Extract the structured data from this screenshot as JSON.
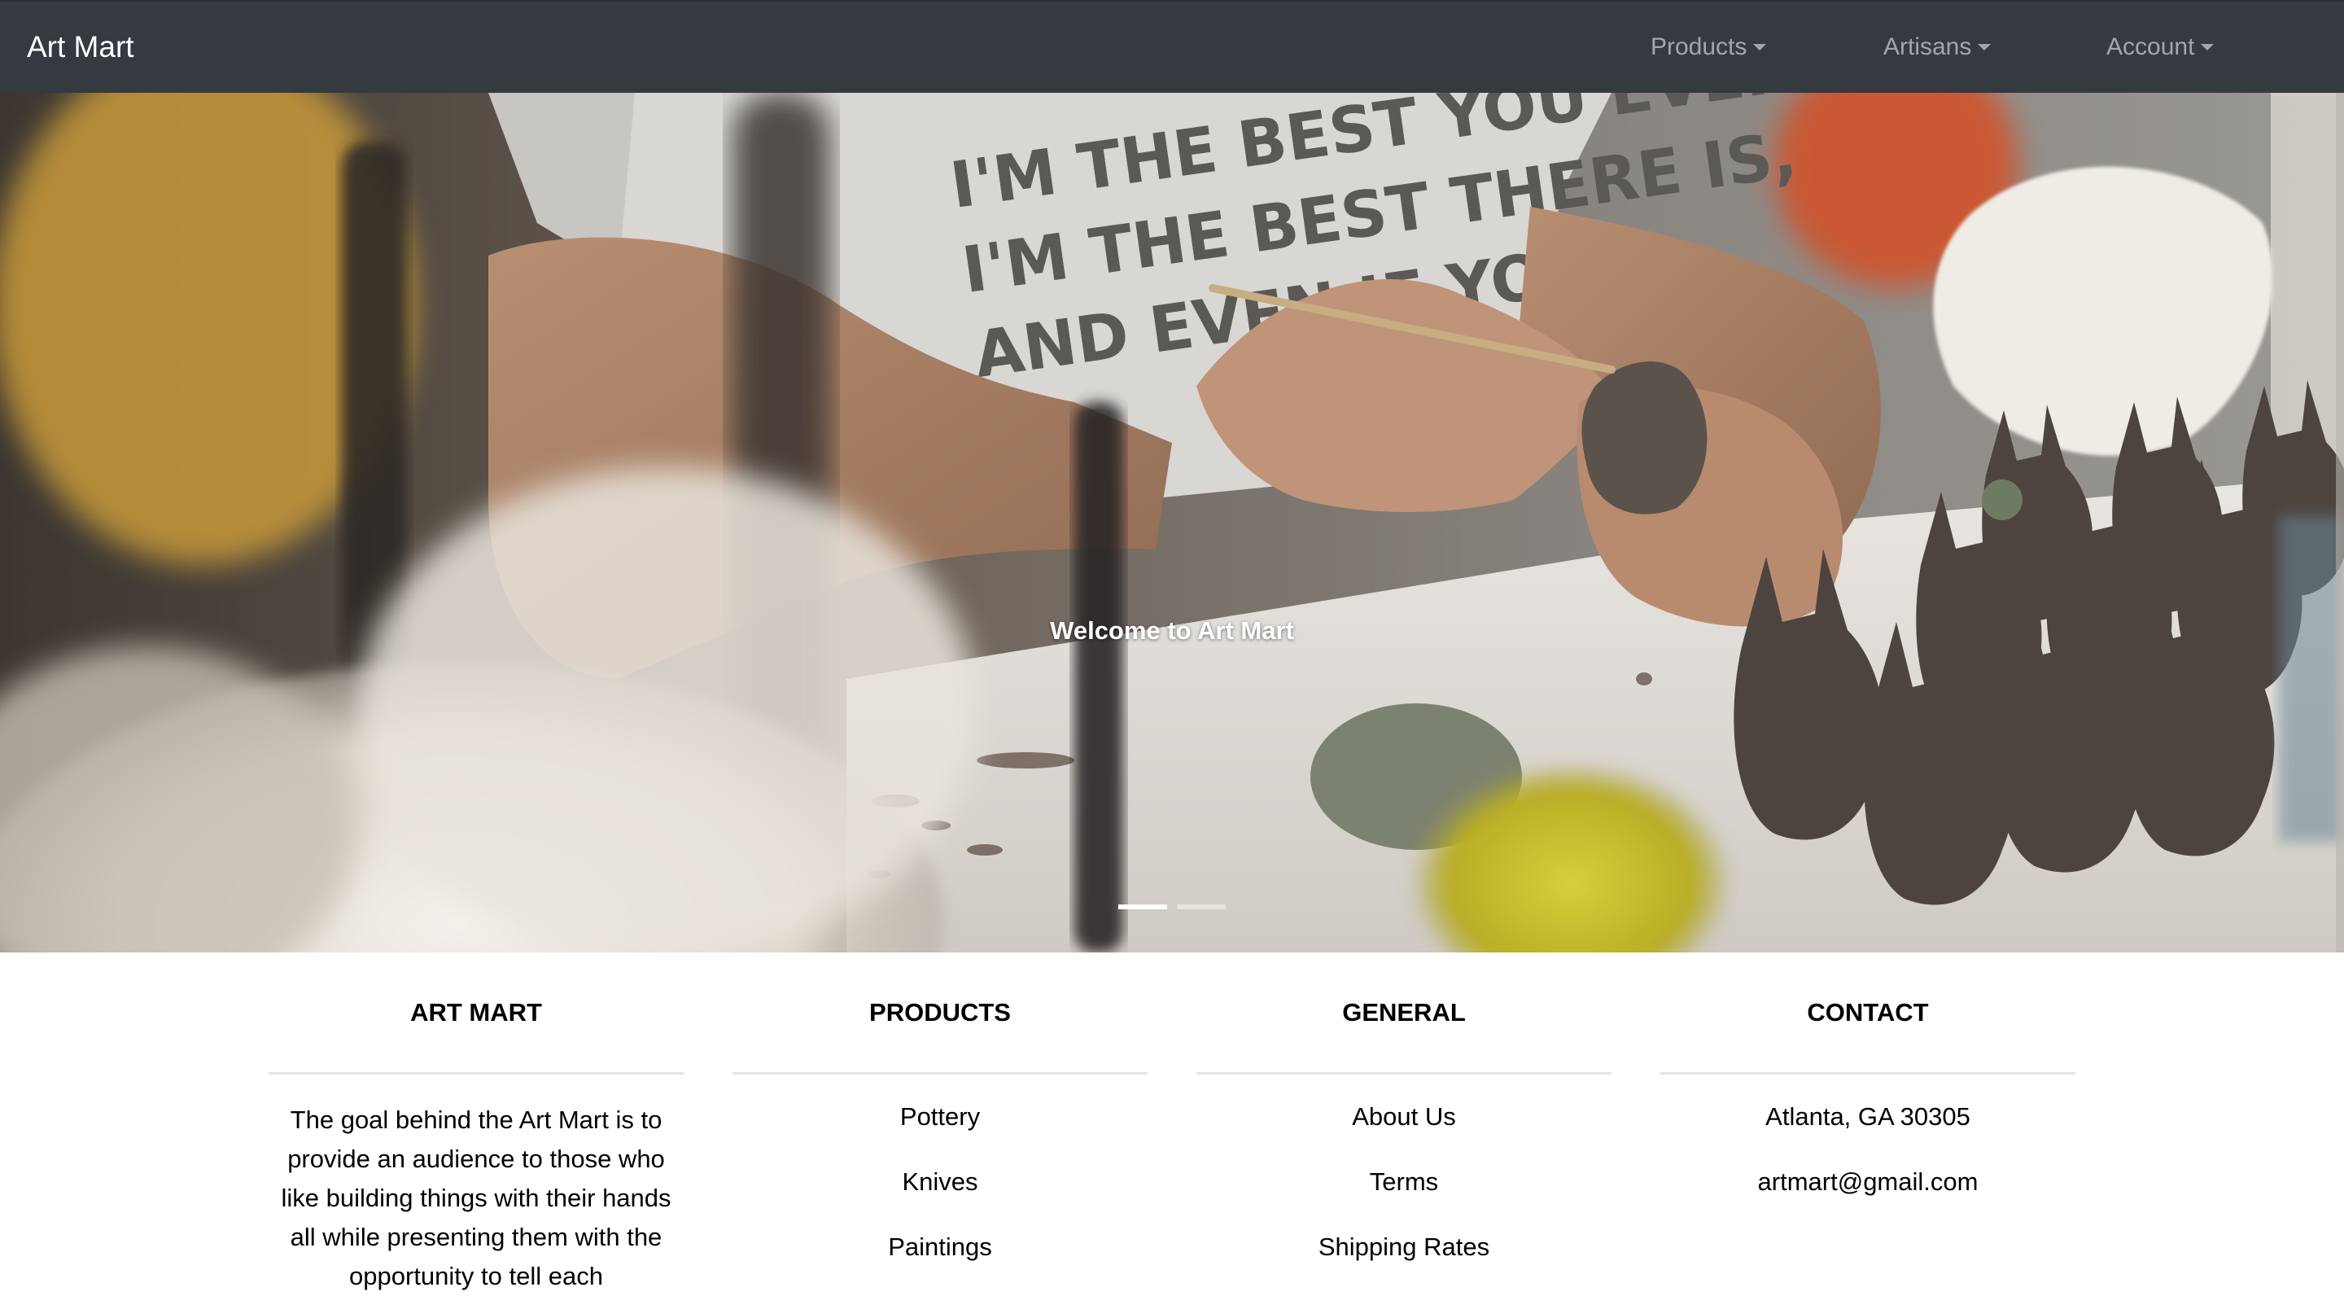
{
  "navbar": {
    "brand": "Art Mart",
    "items": [
      {
        "label": "Products"
      },
      {
        "label": "Artisans"
      },
      {
        "label": "Account"
      }
    ]
  },
  "hero": {
    "caption": "Welcome to Art Mart",
    "shirt_text_lines": [
      "I'M THE BEST YOU EVER",
      "I'M THE BEST THERE IS,",
      "AND EVEN IF YOU B"
    ],
    "active_slide": 1,
    "slide_count": 2
  },
  "footer": {
    "art_mart": {
      "heading": "ART MART",
      "text": "The goal behind the Art Mart is to provide an audience to those who like building things with their hands all while presenting them with the opportunity to tell each"
    },
    "products": {
      "heading": "PRODUCTS",
      "links": [
        "Pottery",
        "Knives",
        "Paintings"
      ]
    },
    "general": {
      "heading": "GENERAL",
      "links": [
        "About Us",
        "Terms",
        "Shipping Rates"
      ]
    },
    "contact": {
      "heading": "CONTACT",
      "lines": [
        "Atlanta, GA 30305",
        "artmart@gmail.com"
      ]
    }
  },
  "colors": {
    "navbar_bg": "#343a40",
    "nav_link": "rgba(255,255,255,0.55)",
    "brand": "#ffffff",
    "divider": "#e5e5e5"
  }
}
